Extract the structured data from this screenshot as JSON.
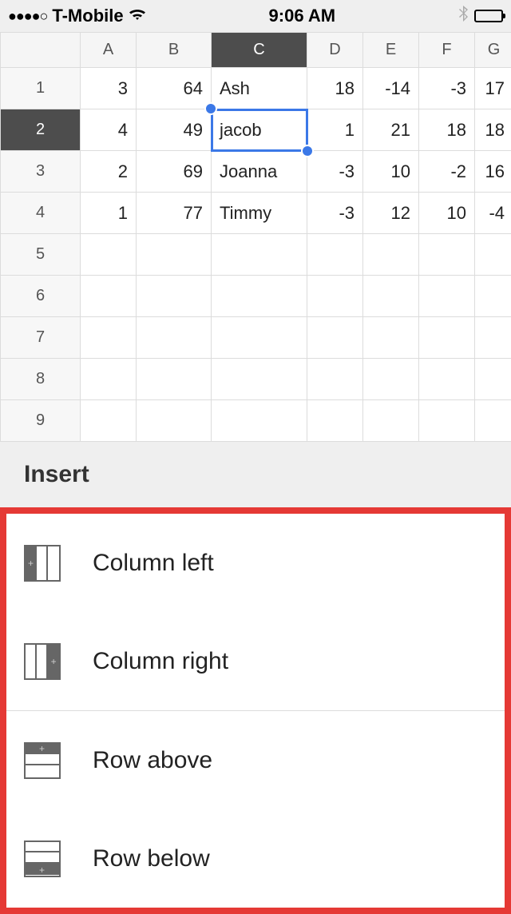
{
  "status_bar": {
    "signal_dots": "●●●●○",
    "carrier": "T-Mobile",
    "time": "9:06 AM"
  },
  "spreadsheet": {
    "columns": [
      "A",
      "B",
      "C",
      "D",
      "E",
      "F",
      "G"
    ],
    "row_headers": [
      "1",
      "2",
      "3",
      "4",
      "5",
      "6",
      "7",
      "8",
      "9"
    ],
    "selected_cell": "C2",
    "selected_column": "C",
    "selected_row": "2",
    "rows": [
      {
        "A": "3",
        "B": "64",
        "C": "Ash",
        "D": "18",
        "E": "-14",
        "F": "-3",
        "G": "17"
      },
      {
        "A": "4",
        "B": "49",
        "C": "jacob",
        "D": "1",
        "E": "21",
        "F": "18",
        "G": "18"
      },
      {
        "A": "2",
        "B": "69",
        "C": "Joanna",
        "D": "-3",
        "E": "10",
        "F": "-2",
        "G": "16"
      },
      {
        "A": "1",
        "B": "77",
        "C": "Timmy",
        "D": "-3",
        "E": "12",
        "F": "10",
        "G": "-4"
      }
    ]
  },
  "panel": {
    "title": "Insert",
    "items": {
      "col_left": "Column left",
      "col_right": "Column right",
      "row_above": "Row above",
      "row_below": "Row below"
    }
  }
}
